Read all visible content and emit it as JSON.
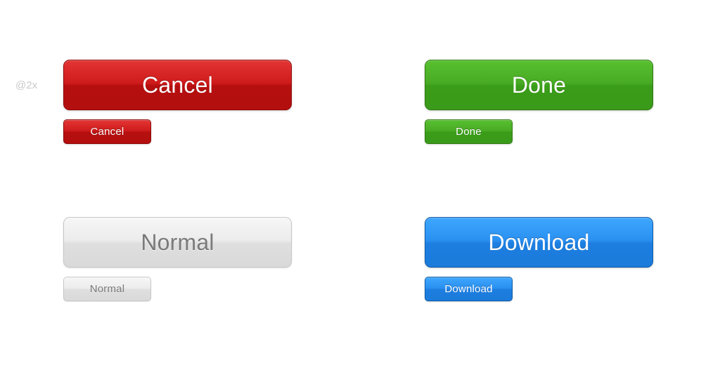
{
  "meta": {
    "retina_label": "@2x"
  },
  "buttons": {
    "cancel": {
      "large_label": "Cancel",
      "small_label": "Cancel",
      "color": "#b50f0f"
    },
    "done": {
      "large_label": "Done",
      "small_label": "Done",
      "color": "#3a9c19"
    },
    "normal": {
      "large_label": "Normal",
      "small_label": "Normal",
      "color": "#dfdfdf"
    },
    "download": {
      "large_label": "Download",
      "small_label": "Download",
      "color": "#1d7ee0"
    }
  }
}
